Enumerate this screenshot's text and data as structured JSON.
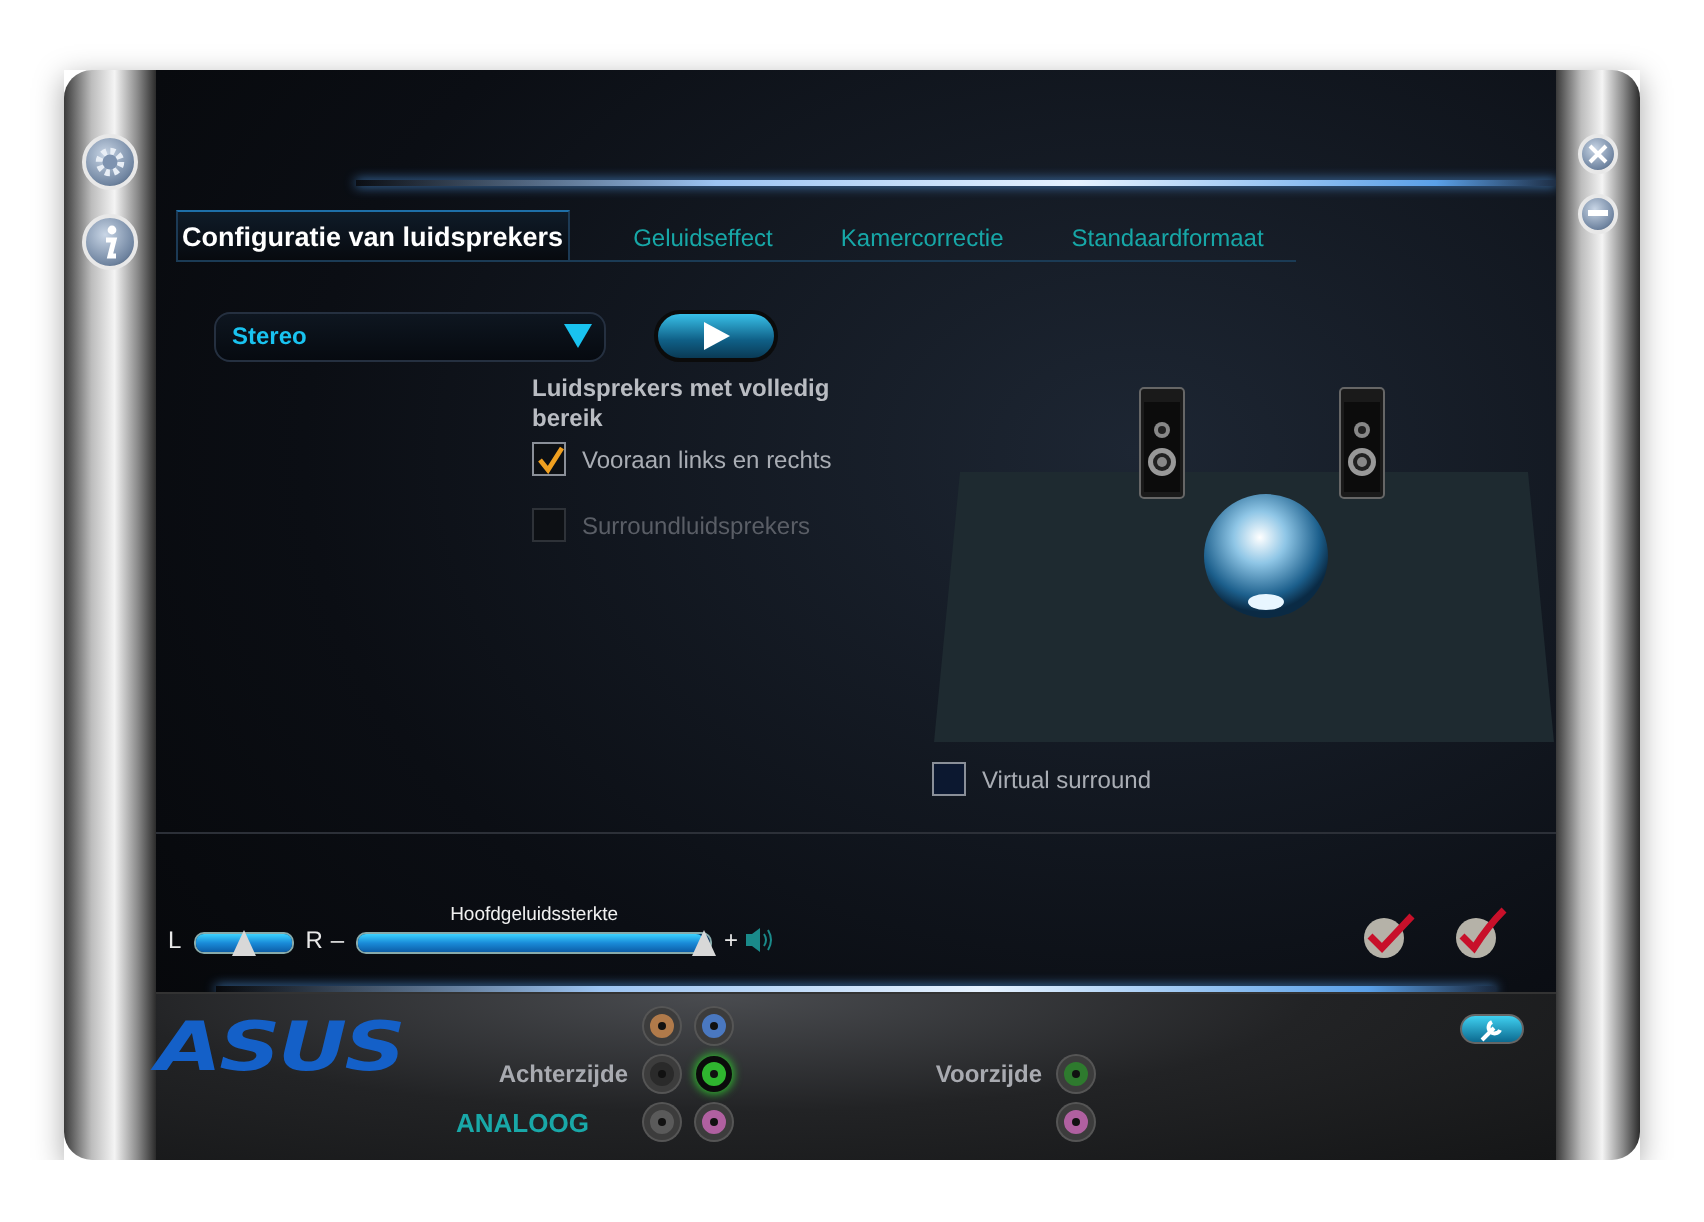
{
  "tabs": [
    {
      "label": "Configuratie van luidsprekers",
      "selected": true
    },
    {
      "label": "Geluidseffect",
      "selected": false
    },
    {
      "label": "Kamercorrectie",
      "selected": false
    },
    {
      "label": "Standaardformaat",
      "selected": false
    }
  ],
  "speaker_config": {
    "value": "Stereo"
  },
  "full_range": {
    "heading": "Luidsprekers met volledig bereik",
    "options": [
      {
        "label": "Vooraan links en rechts",
        "checked": true,
        "disabled": false
      },
      {
        "label": "Surroundluidsprekers",
        "checked": false,
        "disabled": true
      }
    ]
  },
  "virtual_surround": {
    "label": "Virtual surround",
    "checked": false
  },
  "balance": {
    "left_label": "L",
    "right_label": "R",
    "level": 0.5
  },
  "master_volume": {
    "label": "Hoofdgeluidssterkte",
    "minus": "–",
    "plus": "+",
    "level": 0.98
  },
  "logo": "ASUS",
  "connectors": {
    "title": "ANALOOG",
    "rear": {
      "label": "Achterzijde",
      "jacks": [
        {
          "color": "#b07a4a",
          "plugged": false
        },
        {
          "color": "#4a78c0",
          "plugged": false
        },
        {
          "color": "#2a2a2a",
          "plugged": false
        },
        {
          "color": "#2fb52f",
          "plugged": true
        },
        {
          "color": "#5a5a5a",
          "plugged": false
        },
        {
          "color": "#b060a0",
          "plugged": false
        }
      ]
    },
    "front": {
      "label": "Voorzijde",
      "jacks": [
        {
          "color": "#2e7a2e",
          "plugged": false
        },
        {
          "color": "#b060a0",
          "plugged": false
        }
      ]
    }
  }
}
